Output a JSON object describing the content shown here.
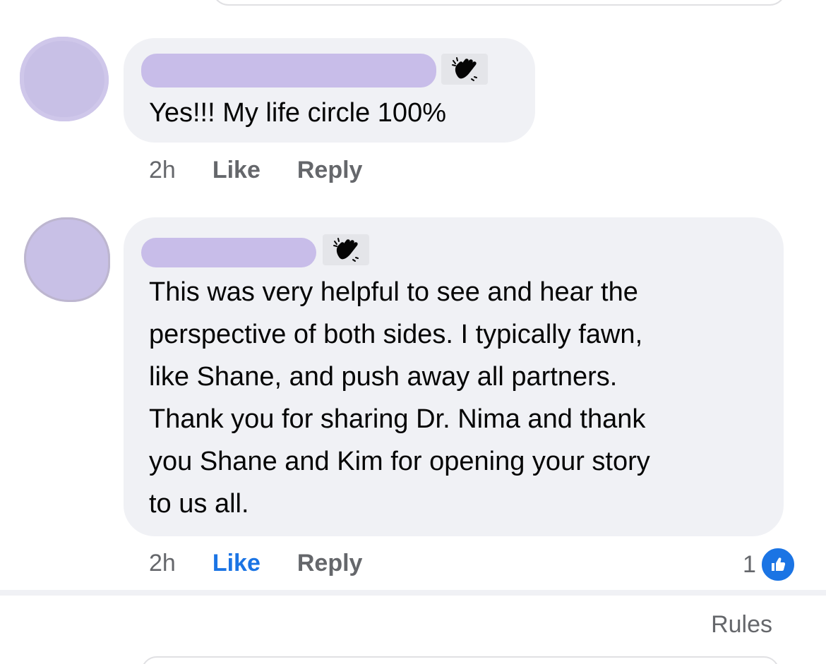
{
  "comments": [
    {
      "author_name": "",
      "badge_icon": "waving-hand-icon",
      "text": "Yes!!! My life circle 100%",
      "time": "2h",
      "like_label": "Like",
      "reply_label": "Reply",
      "liked": false
    },
    {
      "author_name": "",
      "badge_icon": "waving-hand-icon",
      "text": "This was very helpful to see and hear the\nperspective of both sides. I typically fawn,\nlike Shane, and push away all partners.\nThank you for sharing Dr. Nima and thank\nyou Shane and Kim for opening your story\nto us all.",
      "time": "2h",
      "like_label": "Like",
      "reply_label": "Reply",
      "liked": true,
      "reaction_count": "1",
      "reaction_icon": "thumbs-up-icon"
    }
  ],
  "footer": {
    "rules_label": "Rules"
  },
  "colors": {
    "bubble_bg": "#f0f1f5",
    "redaction": "#c8bde9",
    "like_active": "#1b74e4",
    "secondary_text": "#65676b"
  }
}
